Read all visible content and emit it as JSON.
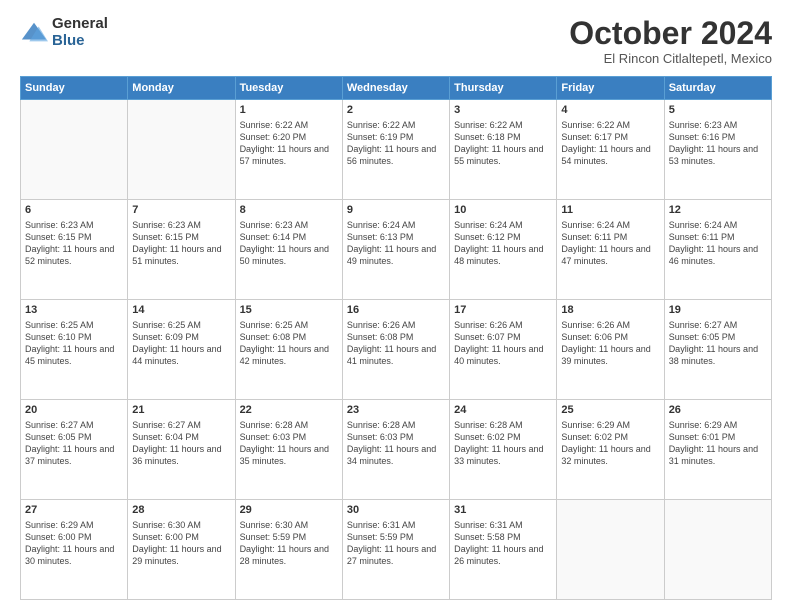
{
  "header": {
    "logo_general": "General",
    "logo_blue": "Blue",
    "month_title": "October 2024",
    "location": "El Rincon Citlaltepetl, Mexico"
  },
  "weekdays": [
    "Sunday",
    "Monday",
    "Tuesday",
    "Wednesday",
    "Thursday",
    "Friday",
    "Saturday"
  ],
  "weeks": [
    [
      {
        "day": "",
        "sunrise": "",
        "sunset": "",
        "daylight": ""
      },
      {
        "day": "",
        "sunrise": "",
        "sunset": "",
        "daylight": ""
      },
      {
        "day": "1",
        "sunrise": "Sunrise: 6:22 AM",
        "sunset": "Sunset: 6:20 PM",
        "daylight": "Daylight: 11 hours and 57 minutes."
      },
      {
        "day": "2",
        "sunrise": "Sunrise: 6:22 AM",
        "sunset": "Sunset: 6:19 PM",
        "daylight": "Daylight: 11 hours and 56 minutes."
      },
      {
        "day": "3",
        "sunrise": "Sunrise: 6:22 AM",
        "sunset": "Sunset: 6:18 PM",
        "daylight": "Daylight: 11 hours and 55 minutes."
      },
      {
        "day": "4",
        "sunrise": "Sunrise: 6:22 AM",
        "sunset": "Sunset: 6:17 PM",
        "daylight": "Daylight: 11 hours and 54 minutes."
      },
      {
        "day": "5",
        "sunrise": "Sunrise: 6:23 AM",
        "sunset": "Sunset: 6:16 PM",
        "daylight": "Daylight: 11 hours and 53 minutes."
      }
    ],
    [
      {
        "day": "6",
        "sunrise": "Sunrise: 6:23 AM",
        "sunset": "Sunset: 6:15 PM",
        "daylight": "Daylight: 11 hours and 52 minutes."
      },
      {
        "day": "7",
        "sunrise": "Sunrise: 6:23 AM",
        "sunset": "Sunset: 6:15 PM",
        "daylight": "Daylight: 11 hours and 51 minutes."
      },
      {
        "day": "8",
        "sunrise": "Sunrise: 6:23 AM",
        "sunset": "Sunset: 6:14 PM",
        "daylight": "Daylight: 11 hours and 50 minutes."
      },
      {
        "day": "9",
        "sunrise": "Sunrise: 6:24 AM",
        "sunset": "Sunset: 6:13 PM",
        "daylight": "Daylight: 11 hours and 49 minutes."
      },
      {
        "day": "10",
        "sunrise": "Sunrise: 6:24 AM",
        "sunset": "Sunset: 6:12 PM",
        "daylight": "Daylight: 11 hours and 48 minutes."
      },
      {
        "day": "11",
        "sunrise": "Sunrise: 6:24 AM",
        "sunset": "Sunset: 6:11 PM",
        "daylight": "Daylight: 11 hours and 47 minutes."
      },
      {
        "day": "12",
        "sunrise": "Sunrise: 6:24 AM",
        "sunset": "Sunset: 6:11 PM",
        "daylight": "Daylight: 11 hours and 46 minutes."
      }
    ],
    [
      {
        "day": "13",
        "sunrise": "Sunrise: 6:25 AM",
        "sunset": "Sunset: 6:10 PM",
        "daylight": "Daylight: 11 hours and 45 minutes."
      },
      {
        "day": "14",
        "sunrise": "Sunrise: 6:25 AM",
        "sunset": "Sunset: 6:09 PM",
        "daylight": "Daylight: 11 hours and 44 minutes."
      },
      {
        "day": "15",
        "sunrise": "Sunrise: 6:25 AM",
        "sunset": "Sunset: 6:08 PM",
        "daylight": "Daylight: 11 hours and 42 minutes."
      },
      {
        "day": "16",
        "sunrise": "Sunrise: 6:26 AM",
        "sunset": "Sunset: 6:08 PM",
        "daylight": "Daylight: 11 hours and 41 minutes."
      },
      {
        "day": "17",
        "sunrise": "Sunrise: 6:26 AM",
        "sunset": "Sunset: 6:07 PM",
        "daylight": "Daylight: 11 hours and 40 minutes."
      },
      {
        "day": "18",
        "sunrise": "Sunrise: 6:26 AM",
        "sunset": "Sunset: 6:06 PM",
        "daylight": "Daylight: 11 hours and 39 minutes."
      },
      {
        "day": "19",
        "sunrise": "Sunrise: 6:27 AM",
        "sunset": "Sunset: 6:05 PM",
        "daylight": "Daylight: 11 hours and 38 minutes."
      }
    ],
    [
      {
        "day": "20",
        "sunrise": "Sunrise: 6:27 AM",
        "sunset": "Sunset: 6:05 PM",
        "daylight": "Daylight: 11 hours and 37 minutes."
      },
      {
        "day": "21",
        "sunrise": "Sunrise: 6:27 AM",
        "sunset": "Sunset: 6:04 PM",
        "daylight": "Daylight: 11 hours and 36 minutes."
      },
      {
        "day": "22",
        "sunrise": "Sunrise: 6:28 AM",
        "sunset": "Sunset: 6:03 PM",
        "daylight": "Daylight: 11 hours and 35 minutes."
      },
      {
        "day": "23",
        "sunrise": "Sunrise: 6:28 AM",
        "sunset": "Sunset: 6:03 PM",
        "daylight": "Daylight: 11 hours and 34 minutes."
      },
      {
        "day": "24",
        "sunrise": "Sunrise: 6:28 AM",
        "sunset": "Sunset: 6:02 PM",
        "daylight": "Daylight: 11 hours and 33 minutes."
      },
      {
        "day": "25",
        "sunrise": "Sunrise: 6:29 AM",
        "sunset": "Sunset: 6:02 PM",
        "daylight": "Daylight: 11 hours and 32 minutes."
      },
      {
        "day": "26",
        "sunrise": "Sunrise: 6:29 AM",
        "sunset": "Sunset: 6:01 PM",
        "daylight": "Daylight: 11 hours and 31 minutes."
      }
    ],
    [
      {
        "day": "27",
        "sunrise": "Sunrise: 6:29 AM",
        "sunset": "Sunset: 6:00 PM",
        "daylight": "Daylight: 11 hours and 30 minutes."
      },
      {
        "day": "28",
        "sunrise": "Sunrise: 6:30 AM",
        "sunset": "Sunset: 6:00 PM",
        "daylight": "Daylight: 11 hours and 29 minutes."
      },
      {
        "day": "29",
        "sunrise": "Sunrise: 6:30 AM",
        "sunset": "Sunset: 5:59 PM",
        "daylight": "Daylight: 11 hours and 28 minutes."
      },
      {
        "day": "30",
        "sunrise": "Sunrise: 6:31 AM",
        "sunset": "Sunset: 5:59 PM",
        "daylight": "Daylight: 11 hours and 27 minutes."
      },
      {
        "day": "31",
        "sunrise": "Sunrise: 6:31 AM",
        "sunset": "Sunset: 5:58 PM",
        "daylight": "Daylight: 11 hours and 26 minutes."
      },
      {
        "day": "",
        "sunrise": "",
        "sunset": "",
        "daylight": ""
      },
      {
        "day": "",
        "sunrise": "",
        "sunset": "",
        "daylight": ""
      }
    ]
  ]
}
